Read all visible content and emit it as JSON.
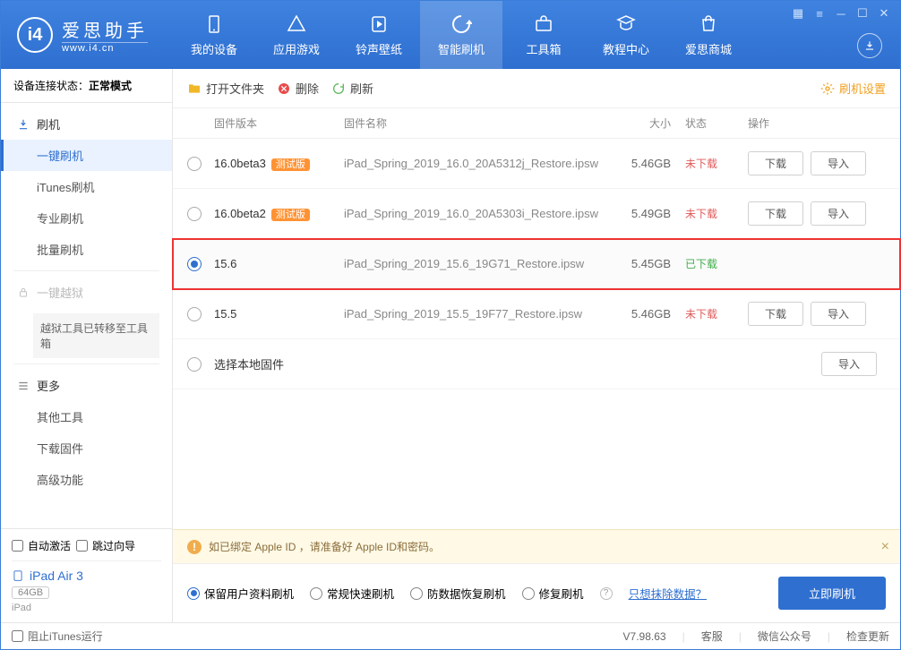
{
  "app": {
    "name": "爱思助手",
    "url": "www.i4.cn"
  },
  "nav": {
    "items": [
      {
        "label": "我的设备"
      },
      {
        "label": "应用游戏"
      },
      {
        "label": "铃声壁纸"
      },
      {
        "label": "智能刷机"
      },
      {
        "label": "工具箱"
      },
      {
        "label": "教程中心"
      },
      {
        "label": "爱思商城"
      }
    ]
  },
  "sidebar": {
    "status_label": "设备连接状态：",
    "status_mode": "正常模式",
    "flash_title": "刷机",
    "items": [
      "一键刷机",
      "iTunes刷机",
      "专业刷机",
      "批量刷机"
    ],
    "jailbreak_title": "一键越狱",
    "jailbreak_note": "越狱工具已转移至工具箱",
    "more_title": "更多",
    "more_items": [
      "其他工具",
      "下载固件",
      "高级功能"
    ],
    "auto_activate": "自动激活",
    "skip_guide": "跳过向导",
    "device_name": "iPad Air 3",
    "device_capacity": "64GB",
    "device_type": "iPad"
  },
  "toolbar": {
    "open_folder": "打开文件夹",
    "delete": "删除",
    "refresh": "刷新",
    "settings": "刷机设置"
  },
  "table": {
    "headers": {
      "version": "固件版本",
      "name": "固件名称",
      "size": "大小",
      "status": "状态",
      "ops": "操作"
    },
    "btn_download": "下载",
    "btn_import": "导入",
    "badge_beta": "测试版",
    "rows": [
      {
        "version": "16.0beta3",
        "beta": true,
        "name": "iPad_Spring_2019_16.0_20A5312j_Restore.ipsw",
        "size": "5.46GB",
        "status": "未下载",
        "downloaded": false,
        "selected": false
      },
      {
        "version": "16.0beta2",
        "beta": true,
        "name": "iPad_Spring_2019_16.0_20A5303i_Restore.ipsw",
        "size": "5.49GB",
        "status": "未下载",
        "downloaded": false,
        "selected": false
      },
      {
        "version": "15.6",
        "beta": false,
        "name": "iPad_Spring_2019_15.6_19G71_Restore.ipsw",
        "size": "5.45GB",
        "status": "已下载",
        "downloaded": true,
        "selected": true,
        "highlight": true
      },
      {
        "version": "15.5",
        "beta": false,
        "name": "iPad_Spring_2019_15.5_19F77_Restore.ipsw",
        "size": "5.46GB",
        "status": "未下载",
        "downloaded": false,
        "selected": false
      }
    ],
    "local_row": "选择本地固件"
  },
  "warning": "如已绑定 Apple ID ，请准备好 Apple ID和密码。",
  "options": {
    "items": [
      "保留用户资料刷机",
      "常规快速刷机",
      "防数据恢复刷机",
      "修复刷机"
    ],
    "erase_link": "只想抹除数据？",
    "flash_button": "立即刷机"
  },
  "footer": {
    "block_itunes": "阻止iTunes运行",
    "version": "V7.98.63",
    "service": "客服",
    "wechat": "微信公众号",
    "update": "检查更新"
  }
}
